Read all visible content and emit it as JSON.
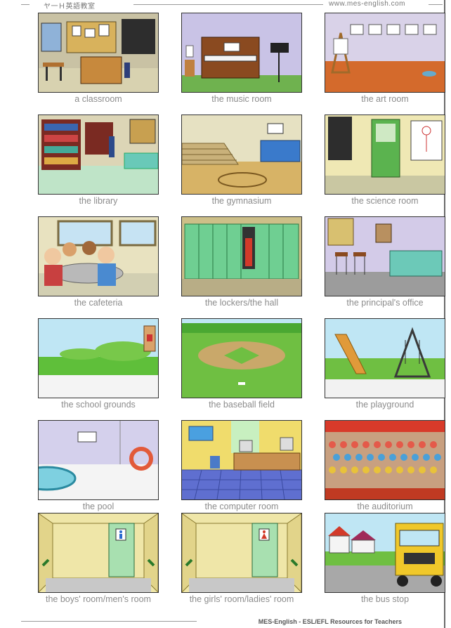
{
  "header": {
    "left_text": "ヤ一Ｈ英語教室",
    "right_text": "www.mes-english.com"
  },
  "footer": {
    "text": "MES-English - ESL/EFL Resources for Teachers"
  },
  "cards": [
    {
      "caption": "a classroom"
    },
    {
      "caption": "the music room"
    },
    {
      "caption": "the art room"
    },
    {
      "caption": "the library"
    },
    {
      "caption": "the gymnasium"
    },
    {
      "caption": "the science room"
    },
    {
      "caption": "the cafeteria"
    },
    {
      "caption": "the lockers/the hall"
    },
    {
      "caption": "the principal's office"
    },
    {
      "caption": "the school grounds"
    },
    {
      "caption": "the baseball field"
    },
    {
      "caption": "the playground"
    },
    {
      "caption": "the pool"
    },
    {
      "caption": "the computer room"
    },
    {
      "caption": "the auditorium"
    },
    {
      "caption": "the boys' room/men's room"
    },
    {
      "caption": "the girls' room/ladies' room"
    },
    {
      "caption": "the bus stop"
    }
  ]
}
